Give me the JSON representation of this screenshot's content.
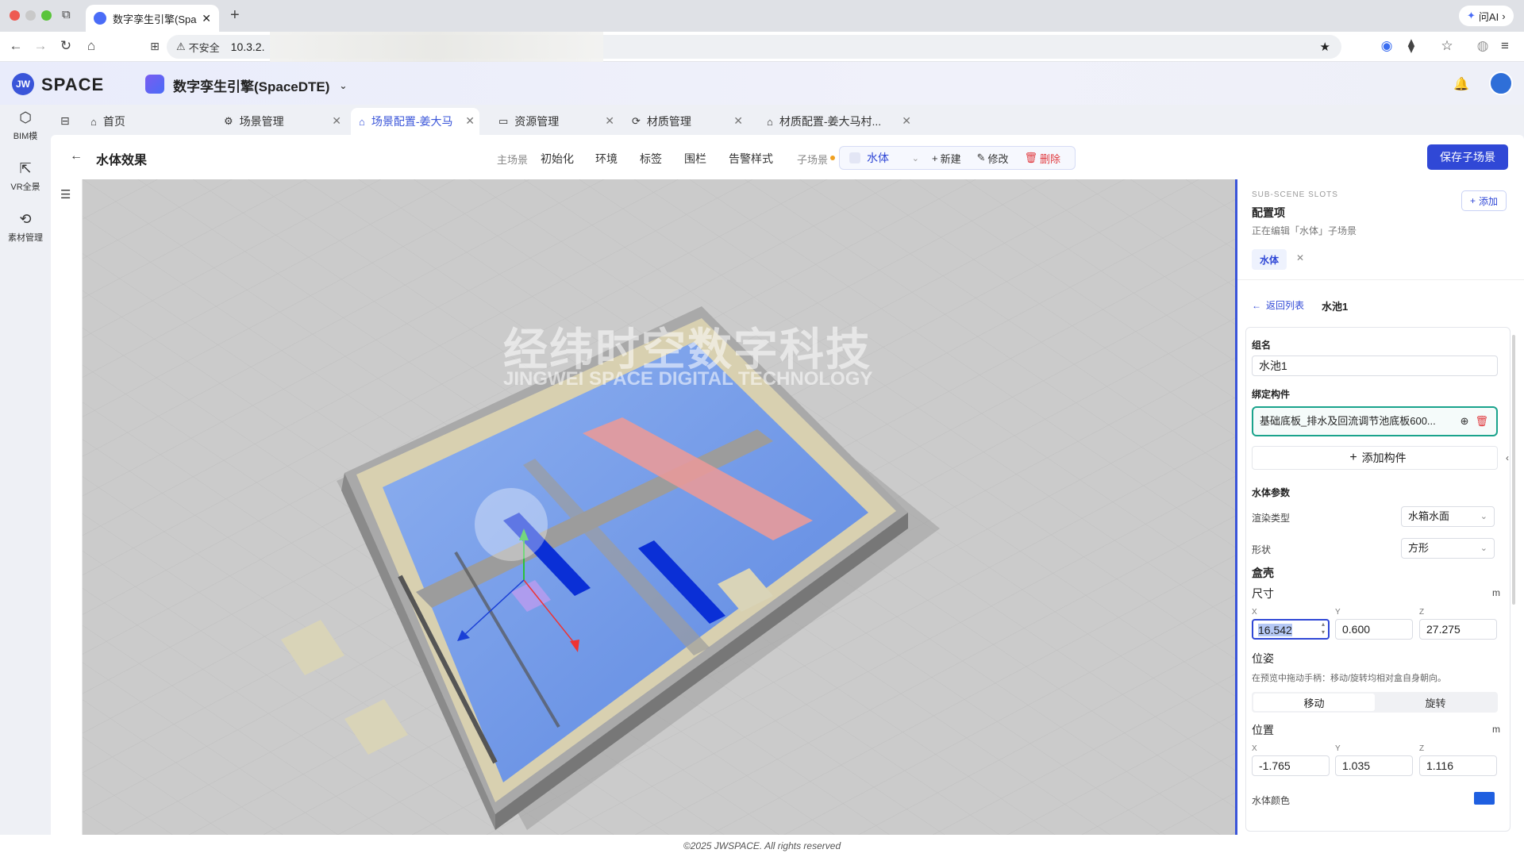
{
  "browser": {
    "tab_title": "数字孪生引擎(Spac",
    "security_label": "不安全",
    "url": "10.3.2.",
    "ai_label": "问AI"
  },
  "app": {
    "logo": "SPACE",
    "project_name": "数字孪生引擎(SpaceDTE)"
  },
  "sidebar": {
    "items": [
      {
        "label": "BIM模",
        "icon": "cube-icon"
      },
      {
        "label": "VR全景",
        "icon": "vr-icon"
      },
      {
        "label": "素材管理",
        "icon": "material-icon"
      }
    ]
  },
  "tabs": [
    {
      "label": "首页",
      "icon": "home-icon",
      "closable": false
    },
    {
      "label": "场景管理",
      "icon": "gear-icon",
      "closable": true
    },
    {
      "label": "场景配置-姜大马",
      "icon": "home-icon",
      "closable": true,
      "active": true
    },
    {
      "label": "资源管理",
      "icon": "monitor-icon",
      "closable": true
    },
    {
      "label": "材质管理",
      "icon": "material-icon",
      "closable": true
    },
    {
      "label": "材质配置-姜大马村...",
      "icon": "home-icon",
      "closable": true
    }
  ],
  "page": {
    "back_label": "←",
    "title": "水体效果",
    "main_scene_label": "主场景",
    "modes": [
      "初始化",
      "环境",
      "标签",
      "围栏",
      "告警样式"
    ],
    "sub_scene_label": "子场景",
    "sub_scene_value": "水体",
    "new_label": "新建",
    "edit_label": "修改",
    "delete_label": "删除",
    "save_label": "保存子场景"
  },
  "viewport": {
    "watermark": "经纬时空数字科技",
    "watermark_sub": "JINGWEI SPACE DIGITAL TECHNOLOGY"
  },
  "panel": {
    "section_tag": "SUB-SCENE SLOTS",
    "title": "配置项",
    "subtitle": "正在编辑「水体」子场景",
    "add_label": "添加",
    "chip": "水体",
    "back_to_list": "返回列表",
    "current_item": "水池1",
    "group_name_label": "组名",
    "group_name_value": "水池1",
    "bind_label": "绑定构件",
    "bind_value": "基础底板_排水及回流调节池底板600...",
    "add_component_label": "添加构件",
    "water_params_label": "水体参数",
    "render_type_label": "渲染类型",
    "render_type_value": "水箱水面",
    "shape_label": "形状",
    "shape_value": "方形",
    "box_label": "盒壳",
    "size_label": "尺寸",
    "size_unit": "m",
    "size": {
      "x_label": "X",
      "y_label": "Y",
      "z_label": "Z",
      "x": "16.542",
      "y": "0.600",
      "z": "27.275"
    },
    "pose_label": "位姿",
    "pose_hint": "在预览中拖动手柄：移动/旋转均相对盒自身朝向。",
    "move_label": "移动",
    "rotate_label": "旋转",
    "position_label": "位置",
    "position_unit": "m",
    "position": {
      "x_label": "X",
      "y_label": "Y",
      "z_label": "Z",
      "x": "-1.765",
      "y": "1.035",
      "z": "1.116"
    },
    "water_color_label": "水体颜色",
    "water_color": "#1f5fe0"
  },
  "footer": "©2025 JWSPACE. All rights reserved",
  "colors": {
    "accent": "#3048d6",
    "danger": "#e0393e",
    "water": "#6f9ae8"
  }
}
